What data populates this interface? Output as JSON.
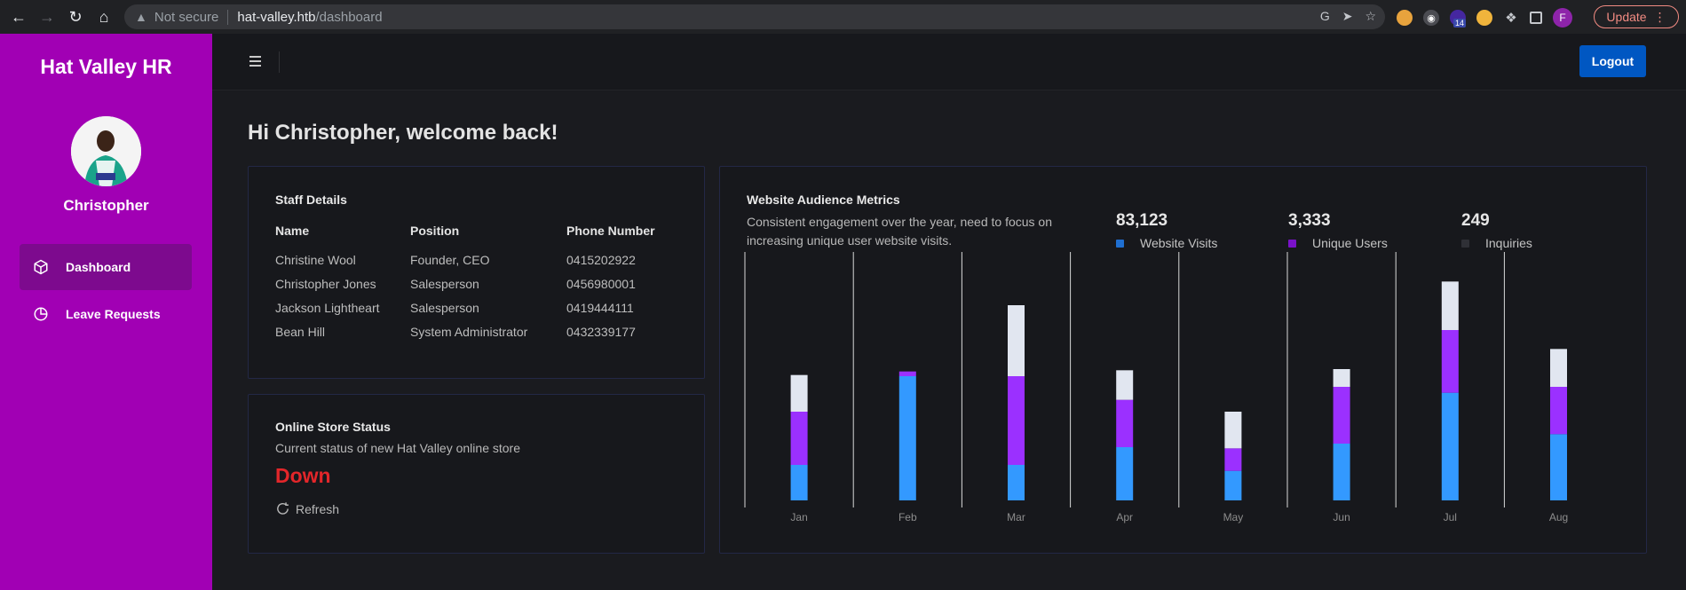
{
  "browser": {
    "not_secure": "Not secure",
    "url_host": "hat-valley.htb",
    "url_path": "/dashboard",
    "update_label": "Update",
    "extension_badge": "14",
    "profile_initial": "F"
  },
  "sidebar": {
    "brand": "Hat Valley HR",
    "user_name": "Christopher",
    "items": [
      {
        "label": "Dashboard",
        "icon": "cube-icon"
      },
      {
        "label": "Leave Requests",
        "icon": "pie-chart-icon"
      }
    ]
  },
  "topnav": {
    "logout_label": "Logout"
  },
  "welcome": "Hi Christopher, welcome back!",
  "staff": {
    "title": "Staff Details",
    "headers": [
      "Name",
      "Position",
      "Phone Number"
    ],
    "rows": [
      [
        "Christine Wool",
        "Founder, CEO",
        "0415202922"
      ],
      [
        "Christopher Jones",
        "Salesperson",
        "0456980001"
      ],
      [
        "Jackson Lightheart",
        "Salesperson",
        "0419444111"
      ],
      [
        "Bean Hill",
        "System Administrator",
        "0432339177"
      ]
    ]
  },
  "store": {
    "title": "Online Store Status",
    "subtitle": "Current status of new Hat Valley online store",
    "status": "Down",
    "refresh_label": "Refresh"
  },
  "metrics": {
    "title": "Website Audience Metrics",
    "subtitle": "Consistent engagement over the year, need to focus on increasing unique user website visits.",
    "stats": [
      {
        "value": "83,123",
        "label": "Website Visits",
        "color": "#2e86f5"
      },
      {
        "value": "3,333",
        "label": "Unique Users",
        "color": "#8a1ee0"
      },
      {
        "value": "249",
        "label": "Inquiries",
        "color": "#2f3036"
      }
    ]
  },
  "chart_data": {
    "type": "bar",
    "stacked": true,
    "categories": [
      "Jan",
      "Feb",
      "Mar",
      "Apr",
      "May",
      "Jun",
      "Jul",
      "Aug"
    ],
    "series": [
      {
        "color": "#3399ff",
        "values": [
          30,
          105,
          30,
          45,
          25,
          48,
          91,
          56
        ]
      },
      {
        "color": "#9b30ff",
        "values": [
          45,
          4,
          75,
          40,
          19,
          48,
          53,
          40
        ]
      },
      {
        "color": "#e1e6f0",
        "values": [
          31,
          0,
          60,
          25,
          31,
          15,
          41,
          32
        ]
      }
    ],
    "ylim": [
      0,
      210
    ],
    "grid": false
  }
}
